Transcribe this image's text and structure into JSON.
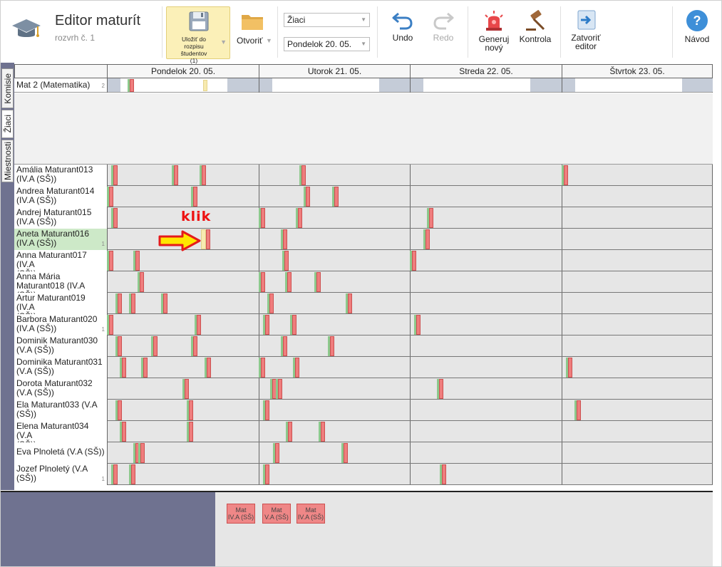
{
  "app": {
    "title": "Editor maturít",
    "subtitle": "rozvrh č. 1"
  },
  "toolbar": {
    "save_label": "Uložiť do rozpisu študentov",
    "save_count": "(1)",
    "open_label": "Otvoriť",
    "view_select": "Žiaci",
    "day_select": "Pondelok 20. 05.",
    "undo_label": "Undo",
    "redo_label": "Redo",
    "generate_label_1": "Generuj",
    "generate_label_2": "nový",
    "check_label": "Kontrola",
    "close_label_1": "Zatvoriť",
    "close_label_2": "editor",
    "help_label": "Návod"
  },
  "sidetabs": [
    "Komisie",
    "Žiaci",
    "Miestnosti"
  ],
  "days": [
    "Pondelok 20. 05.",
    "Utorok 21. 05.",
    "Streda 22. 05.",
    "Štvrtok 23. 05."
  ],
  "committee": {
    "label": "Mat 2 (Matematika)",
    "index": "2"
  },
  "students": [
    {
      "line1": "Amália Maturant013",
      "line2": "(IV.A (SŠ))",
      "index": ""
    },
    {
      "line1": "Andrea Maturant014",
      "line2": "(IV.A (SŠ))",
      "index": ""
    },
    {
      "line1": "Andrej Maturant015",
      "line2": "(IV.A (SŠ))",
      "index": ""
    },
    {
      "line1": "Aneta Maturant016",
      "line2": "(IV.A (SŠ))",
      "index": "1"
    },
    {
      "line1": "Anna Maturant017 (IV.A",
      "line2": "(SŠ))",
      "index": ""
    },
    {
      "line1": "Anna Mária",
      "line2": "Maturant018 (IV.A (SŠ))",
      "index": ""
    },
    {
      "line1": "Artur Maturant019 (IV.A",
      "line2": "(SŠ))",
      "index": ""
    },
    {
      "line1": "Barbora Maturant020",
      "line2": "(IV.A (SŠ))",
      "index": "1"
    },
    {
      "line1": "Dominik Maturant030",
      "line2": "(V.A (SŠ))",
      "index": ""
    },
    {
      "line1": "Dominika Maturant031",
      "line2": "(V.A (SŠ))",
      "index": ""
    },
    {
      "line1": "Dorota Maturant032",
      "line2": "(V.A (SŠ))",
      "index": ""
    },
    {
      "line1": "Ela Maturant033 (V.A",
      "line2": "(SŠ))",
      "index": ""
    },
    {
      "line1": "Elena Maturant034 (V.A",
      "line2": "(SŠ))",
      "index": ""
    },
    {
      "line1": "Eva Plnoletá (V.A (SŠ))",
      "line2": "",
      "index": ""
    },
    {
      "line1": "Jozef Plnoletý (V.A",
      "line2": "(SŠ))",
      "index": "1"
    }
  ],
  "unassigned": [
    {
      "line1": "Mat",
      "line2": "IV.A (SŠ)"
    },
    {
      "line1": "Mat",
      "line2": "V.A (SŠ)"
    },
    {
      "line1": "Mat",
      "line2": "IV.A (SŠ)"
    }
  ],
  "annotation": {
    "text": "klik"
  }
}
